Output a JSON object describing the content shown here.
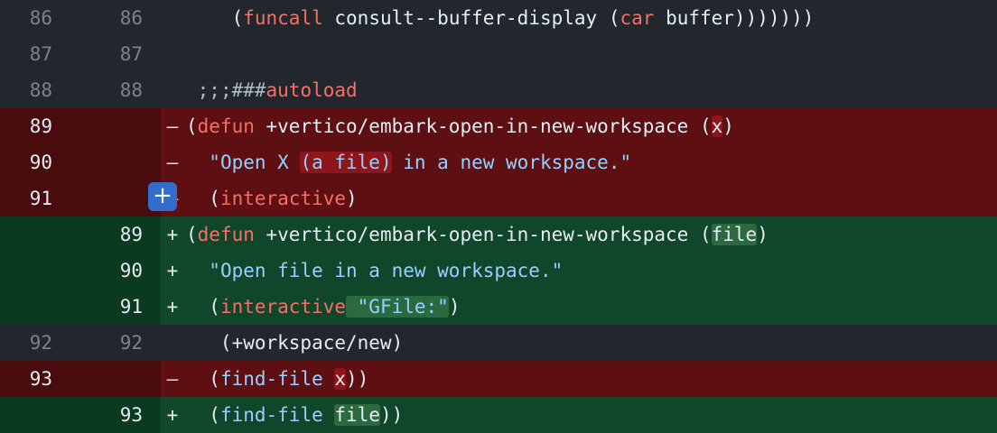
{
  "rows": [
    {
      "type": "ctx",
      "old": "86",
      "new": "86",
      "sign": "",
      "parts": [
        [
          "tx",
          "    "
        ],
        [
          "tx",
          "("
        ],
        [
          "kw",
          "funcall"
        ],
        [
          "tx",
          " consult--buffer-display ("
        ],
        [
          "kw",
          "car"
        ],
        [
          "tx",
          " buffer)))))))"
        ]
      ]
    },
    {
      "type": "ctx",
      "old": "87",
      "new": "87",
      "sign": "",
      "parts": []
    },
    {
      "type": "ctx",
      "old": "88",
      "new": "88",
      "sign": "",
      "parts": [
        [
          "tx",
          " "
        ],
        [
          "cm",
          ";;;###"
        ],
        [
          "kw",
          "autoload"
        ]
      ]
    },
    {
      "type": "del",
      "old": "89",
      "new": "",
      "sign": "–",
      "parts": [
        [
          "tx",
          "("
        ],
        [
          "kw",
          "defun"
        ],
        [
          "tx",
          " +vertico/embark-open-in-new-workspace ("
        ],
        [
          "mkd",
          "x"
        ],
        [
          "tx",
          ")"
        ]
      ]
    },
    {
      "type": "del",
      "old": "90",
      "new": "",
      "sign": "–",
      "parts": [
        [
          "tx",
          "  "
        ],
        [
          "str",
          "\"Open X "
        ],
        [
          "mkdstr",
          "(a file)"
        ],
        [
          "str",
          " in a new workspace.\""
        ]
      ]
    },
    {
      "type": "del",
      "old": "91",
      "new": "",
      "sign": "–",
      "parts": [
        [
          "tx",
          "  ("
        ],
        [
          "kw",
          "interactive"
        ],
        [
          "tx",
          ")"
        ]
      ],
      "expand": true
    },
    {
      "type": "add",
      "old": "",
      "new": "89",
      "sign": "+",
      "parts": [
        [
          "tx",
          "("
        ],
        [
          "kw",
          "defun"
        ],
        [
          "tx",
          " +vertico/embark-open-in-new-workspace ("
        ],
        [
          "mka",
          "file"
        ],
        [
          "tx",
          ")"
        ]
      ]
    },
    {
      "type": "add",
      "old": "",
      "new": "90",
      "sign": "+",
      "parts": [
        [
          "tx",
          "  "
        ],
        [
          "str",
          "\"Open file in a new workspace.\""
        ]
      ]
    },
    {
      "type": "add",
      "old": "",
      "new": "91",
      "sign": "+",
      "parts": [
        [
          "tx",
          "  ("
        ],
        [
          "kw",
          "interactive"
        ],
        [
          "mkastr",
          " \"GFile:\""
        ],
        [
          "tx",
          ")"
        ]
      ]
    },
    {
      "type": "ctx",
      "old": "92",
      "new": "92",
      "sign": "",
      "parts": [
        [
          "tx",
          "   (+workspace/new)"
        ]
      ]
    },
    {
      "type": "del",
      "old": "93",
      "new": "",
      "sign": "–",
      "parts": [
        [
          "tx",
          "  ("
        ],
        [
          "str",
          "find-file"
        ],
        [
          "tx",
          " "
        ],
        [
          "mkd",
          "x"
        ],
        [
          "tx",
          "))"
        ]
      ]
    },
    {
      "type": "add",
      "old": "",
      "new": "93",
      "sign": "+",
      "parts": [
        [
          "tx",
          "  ("
        ],
        [
          "str",
          "find-file"
        ],
        [
          "tx",
          " "
        ],
        [
          "mka",
          "file"
        ],
        [
          "tx",
          "))"
        ]
      ]
    }
  ],
  "expand_button": {
    "label": "+",
    "icon": "plus-icon"
  },
  "colors": {
    "deletion_bg": "#5d0f12",
    "addition_bg": "#10472a",
    "context_bg": "#22272e",
    "accent": "#316dca"
  }
}
